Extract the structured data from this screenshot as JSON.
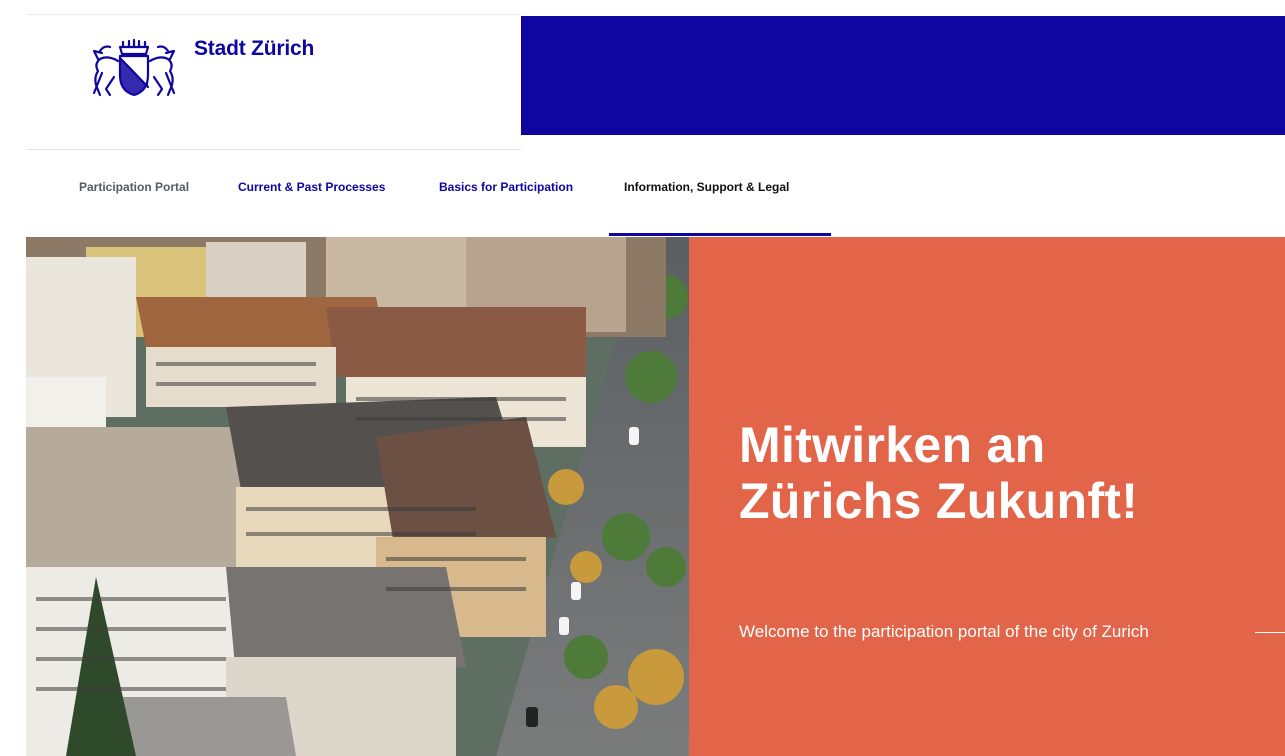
{
  "header": {
    "brand": "Stadt Zürich",
    "logo_icon": "zurich-coat-of-arms-icon",
    "accent_color": "#0f05a0"
  },
  "nav": {
    "items": [
      {
        "label": "Participation Portal",
        "state": "muted"
      },
      {
        "label": "Current & Past Processes",
        "state": "link"
      },
      {
        "label": "Basics for Participation",
        "state": "link"
      },
      {
        "label": "Information, Support & Legal",
        "state": "active"
      }
    ]
  },
  "hero": {
    "title_line1": "Mitwirken an",
    "title_line2": "Zürichs Zukunft!",
    "subtitle": "Welcome to the participation portal of the city of Zurich",
    "panel_color": "#e2654a",
    "image_subject": "aerial view of Zurich city buildings"
  }
}
